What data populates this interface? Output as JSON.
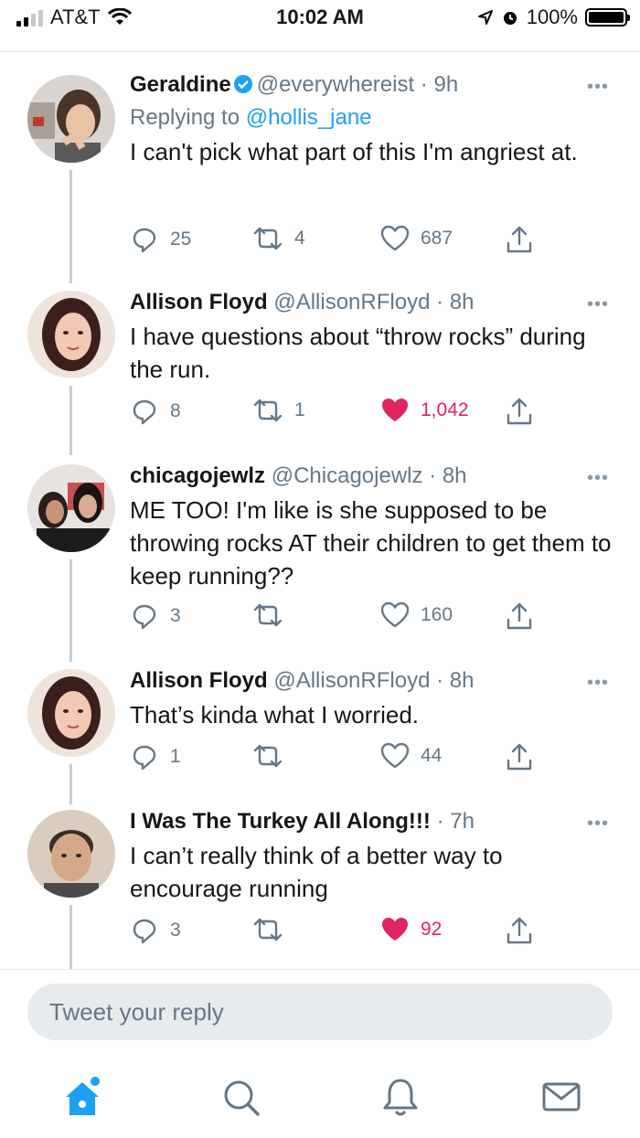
{
  "status": {
    "carrier": "AT&T",
    "time": "10:02 AM",
    "battery": "100%",
    "battery_level": 1.0
  },
  "tweets": [
    {
      "name": "Geraldine",
      "verified": true,
      "handle": "@everywhereist",
      "sep": "·",
      "time": "9h",
      "replying_prefix": "Replying to",
      "replying_to": "@hollis_jane",
      "text": "I can't pick what part of this I'm angriest at.",
      "replies": "25",
      "retweets": "4",
      "likes": "687",
      "liked": false
    },
    {
      "name": "Allison Floyd",
      "handle": "@AllisonRFloyd",
      "sep": "·",
      "time": "8h",
      "text": "I have questions about “throw rocks” during the run.",
      "replies": "8",
      "retweets": "1",
      "likes": "1,042",
      "liked": true
    },
    {
      "name": "chicagojewlz",
      "handle": "@Chicagojewlz",
      "sep": "·",
      "time": "8h",
      "text": "ME TOO! I'm like is she supposed to be throwing rocks AT their children to get them to keep running??",
      "replies": "3",
      "retweets": "",
      "likes": "160",
      "liked": false
    },
    {
      "name": "Allison Floyd",
      "handle": "@AllisonRFloyd",
      "sep": "·",
      "time": "8h",
      "text": "That’s kinda what I worried.",
      "replies": "1",
      "retweets": "",
      "likes": "44",
      "liked": false
    },
    {
      "name": "I Was The Turkey All Along!!!",
      "handle": "",
      "sep": "·",
      "time": "7h",
      "text": "I can’t really think of a better way to encourage running",
      "replies": "3",
      "retweets": "",
      "likes": "92",
      "liked": true
    }
  ],
  "reply_bar": {
    "placeholder": "Tweet your reply"
  },
  "tabs": [
    {
      "icon": "home-icon",
      "active": true
    },
    {
      "icon": "search-icon"
    },
    {
      "icon": "bell-icon"
    },
    {
      "icon": "mail-icon"
    }
  ],
  "colors": {
    "accent": "#1da1f2",
    "like": "#e0245e",
    "muted": "#657786"
  }
}
